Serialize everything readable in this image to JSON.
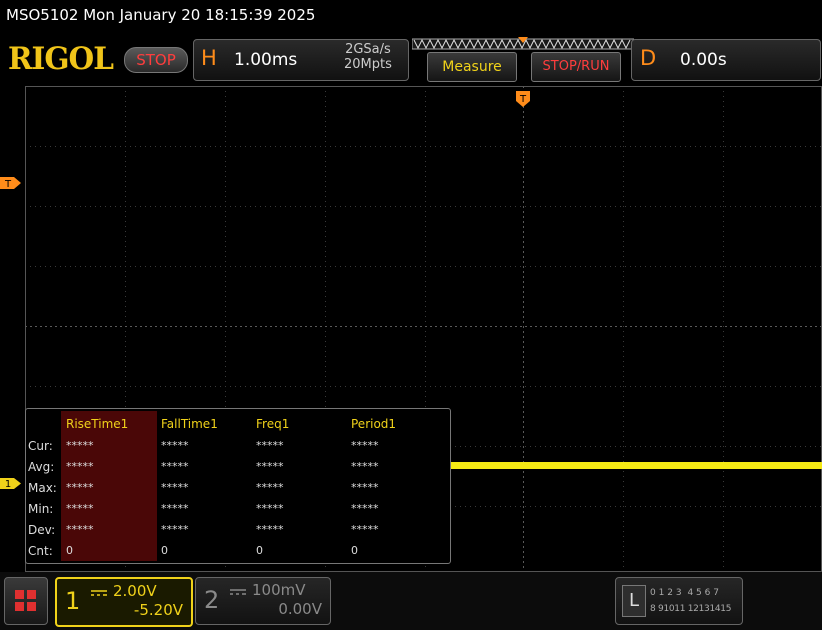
{
  "titlebar": {
    "text": "MSO5102  Mon January 20 18:15:39 2025"
  },
  "header": {
    "logo": "RIGOL",
    "run_state": "STOP",
    "horizontal": {
      "label": "H",
      "timebase": "1.00ms",
      "sample_rate": "2GSa/s",
      "memory_depth": "20Mpts"
    },
    "measure_label": "Measure",
    "stop_run_label": "STOP/RUN",
    "delay": {
      "label": "D",
      "value": "0.00s"
    }
  },
  "markers": {
    "trigger_top": "T",
    "trigger_level": "T",
    "ch1": "1"
  },
  "measurements": {
    "columns": [
      "RiseTime1",
      "FallTime1",
      "Freq1",
      "Period1"
    ],
    "rows": [
      {
        "label": "Cur:",
        "values": [
          "*****",
          "*****",
          "*****",
          "*****"
        ]
      },
      {
        "label": "Avg:",
        "values": [
          "*****",
          "*****",
          "*****",
          "*****"
        ]
      },
      {
        "label": "Max:",
        "values": [
          "*****",
          "*****",
          "*****",
          "*****"
        ]
      },
      {
        "label": "Min:",
        "values": [
          "*****",
          "*****",
          "*****",
          "*****"
        ]
      },
      {
        "label": "Dev:",
        "values": [
          "*****",
          "*****",
          "*****",
          "*****"
        ]
      },
      {
        "label": "Cnt:",
        "values": [
          "0",
          "0",
          "0",
          "0"
        ]
      }
    ]
  },
  "channels": {
    "ch1": {
      "number": "1",
      "scale": "2.00V",
      "offset": "-5.20V",
      "color": "#f0d21a"
    },
    "ch2": {
      "number": "2",
      "scale": "100mV",
      "offset": "0.00V",
      "color": "#7a7a7a"
    }
  },
  "logic": {
    "label": "L",
    "row1": [
      "0",
      "1",
      "2",
      "3",
      "4",
      "5",
      "6",
      "7"
    ],
    "row2": [
      "8",
      "9",
      "10",
      "11",
      "12",
      "13",
      "14",
      "15"
    ]
  }
}
